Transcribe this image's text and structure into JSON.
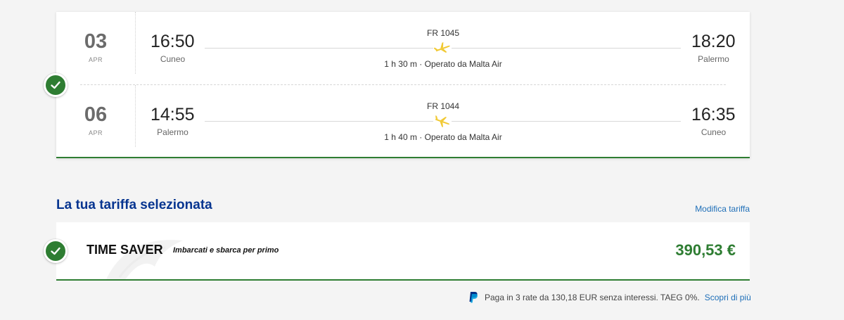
{
  "flights": [
    {
      "day": "03",
      "month": "APR",
      "departure_time": "16:50",
      "departure_city": "Cuneo",
      "flight_number": "FR 1045",
      "duration_operator": "1 h 30 m · Operato da Malta Air",
      "arrival_time": "18:20",
      "arrival_city": "Palermo"
    },
    {
      "day": "06",
      "month": "APR",
      "departure_time": "14:55",
      "departure_city": "Palermo",
      "flight_number": "FR 1044",
      "duration_operator": "1 h 40 m · Operato da Malta Air",
      "arrival_time": "16:35",
      "arrival_city": "Cuneo"
    }
  ],
  "fare": {
    "section_title": "La tua tariffa selezionata",
    "modify_link": "Modifica tariffa",
    "name": "TIME SAVER",
    "description": "Imbarcati e sbarca per primo",
    "price": "390,53 €"
  },
  "paypal": {
    "text": "Paga in 3 rate da 130,18 EUR senza interessi. TAEG 0%.",
    "link": "Scopri di più"
  },
  "colors": {
    "accent_green": "#2e7d32",
    "title_blue": "#073590",
    "link_blue": "#1f6fb8",
    "plane_yellow": "#f1c933"
  },
  "icons": {
    "selected": "check-icon",
    "outbound": "plane-takeoff-icon",
    "return": "plane-landing-icon",
    "payment": "paypal-icon"
  }
}
